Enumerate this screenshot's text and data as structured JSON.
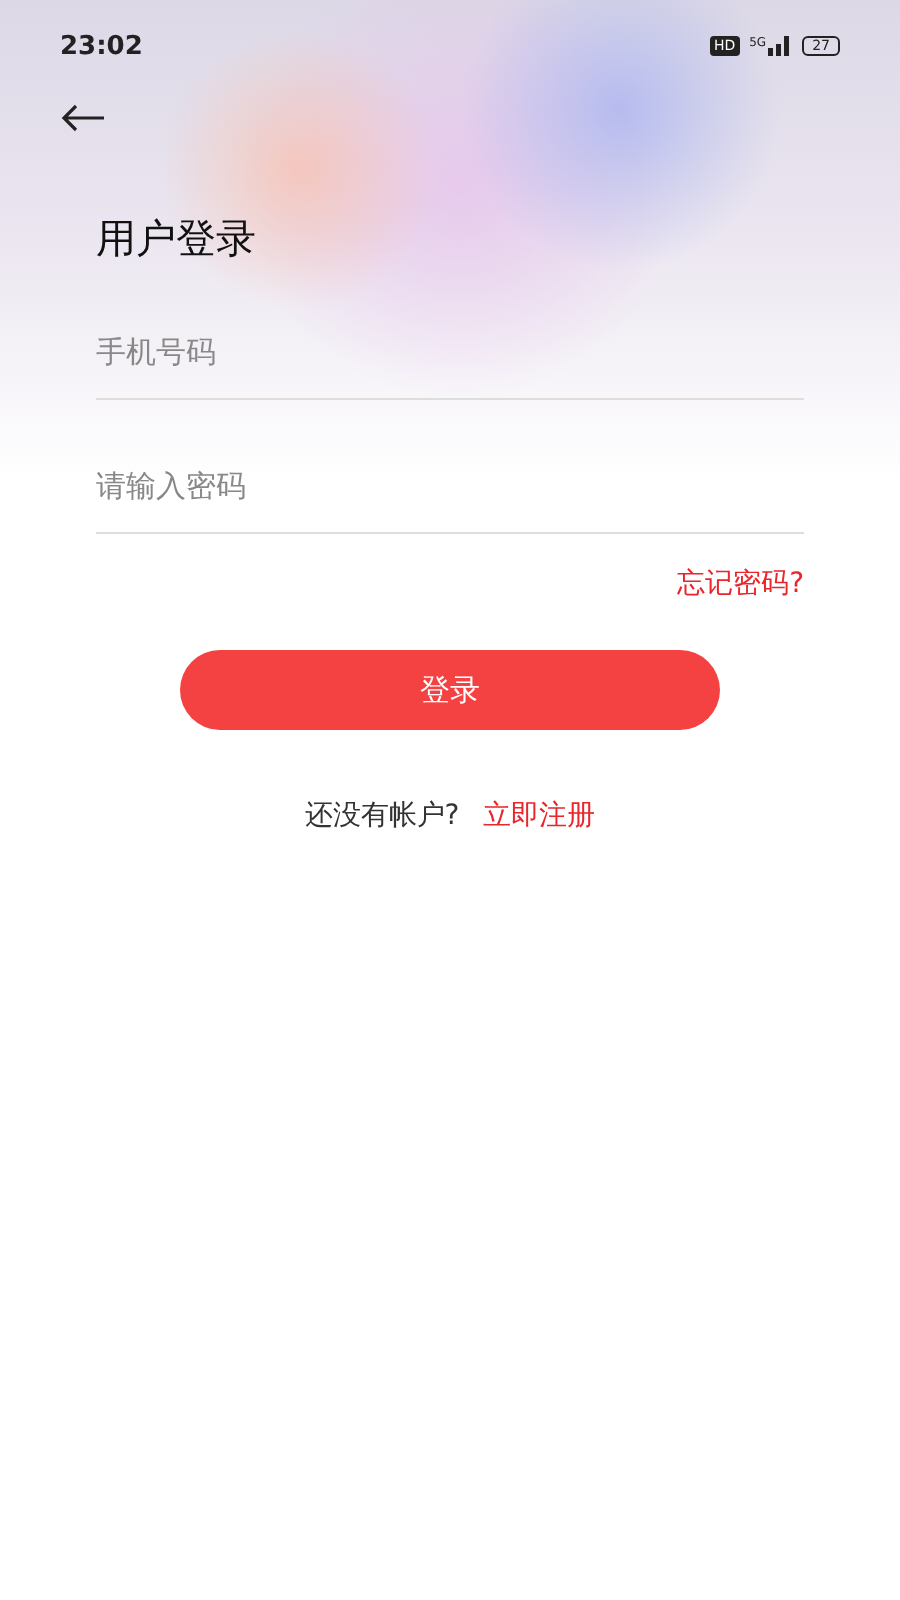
{
  "status_bar": {
    "time": "23:02",
    "hd_badge": "HD",
    "network": "5G",
    "battery": "27"
  },
  "title": "用户登录",
  "fields": [
    {
      "placeholder": "手机号码"
    },
    {
      "placeholder": "请输入密码"
    }
  ],
  "forgot_link": "忘记密码?",
  "login_button": "登录",
  "register_prompt": "还没有帐户?",
  "register_link": "立即注册"
}
